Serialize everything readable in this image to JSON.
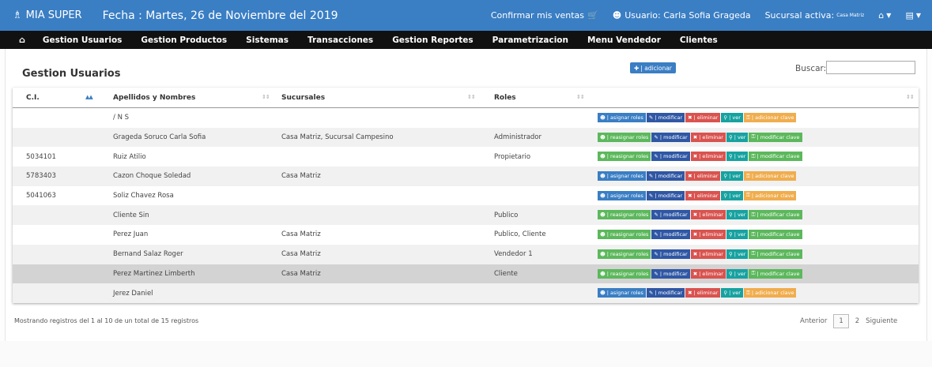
{
  "header": {
    "brand": "MIA SUPER",
    "fecha": "Fecha : Martes, 26 de Noviembre del 2019",
    "confirmar": "Confirmar mis ventas",
    "usuario": "Usuario: Carla Sofia Grageda",
    "sucursal_label": "Sucursal activa:",
    "sucursal_value": "Casa Matriz"
  },
  "nav": {
    "items": [
      "Gestion Usuarios",
      "Gestion Productos",
      "Sistemas",
      "Transacciones",
      "Gestion Reportes",
      "Parametrizacion",
      "Menu Vendedor",
      "Clientes"
    ]
  },
  "page": {
    "title": "Gestion Usuarios",
    "add_label": "| adicionar",
    "search_label": "Buscar:",
    "search_value": ""
  },
  "table": {
    "headers": [
      "C.I.",
      "Apellidos y Nombres",
      "Sucursales",
      "Roles",
      ""
    ],
    "rows": [
      {
        "ci": "",
        "nombre": "/ N S",
        "suc": "",
        "rol": "",
        "tipo": "a"
      },
      {
        "ci": "",
        "nombre": "Grageda Soruco Carla Sofia",
        "suc": "Casa Matriz, Sucursal Campesino",
        "rol": "Administrador",
        "tipo": "b"
      },
      {
        "ci": "5034101",
        "nombre": "Ruiz Atilio",
        "suc": "",
        "rol": "Propietario",
        "tipo": "b"
      },
      {
        "ci": "5783403",
        "nombre": "Cazon Choque Soledad",
        "suc": "Casa Matriz",
        "rol": "",
        "tipo": "a"
      },
      {
        "ci": "5041063",
        "nombre": "Soliz Chavez Rosa",
        "suc": "",
        "rol": "",
        "tipo": "a"
      },
      {
        "ci": "",
        "nombre": "Cliente Sin",
        "suc": "",
        "rol": "Publico",
        "tipo": "b"
      },
      {
        "ci": "",
        "nombre": "Perez Juan",
        "suc": "Casa Matriz",
        "rol": "Publico, Cliente",
        "tipo": "b"
      },
      {
        "ci": "",
        "nombre": "Bernand Salaz Roger",
        "suc": "Casa Matriz",
        "rol": "Vendedor 1",
        "tipo": "b"
      },
      {
        "ci": "",
        "nombre": "Perez Martinez Limberth",
        "suc": "Casa Matriz",
        "rol": "Cliente",
        "tipo": "b"
      },
      {
        "ci": "",
        "nombre": "Jerez Daniel",
        "suc": "",
        "rol": "",
        "tipo": "a"
      }
    ]
  },
  "actions": {
    "asignar": "| asignar roles",
    "reasignar": "| reasignar roles",
    "modificar": "| modificar",
    "eliminar": "| eliminar",
    "ver": "| ver",
    "adicionar_clave": "| adicionar clave",
    "modificar_clave": "| modificar clave"
  },
  "footer_info": {
    "text": "Mostrando registros del 1 al 10 de un total de 15 registros"
  },
  "pager": {
    "prev": "Anterior",
    "pages": [
      "1",
      "2"
    ],
    "next": "Siguiente"
  },
  "colors": {
    "primary": "#3a7ec4",
    "nav_bg": "#111111",
    "success": "#5cb85c",
    "danger": "#d9534f",
    "info": "#17a2a0",
    "warning": "#f0ad4e",
    "dark_blue": "#2f57a4"
  }
}
